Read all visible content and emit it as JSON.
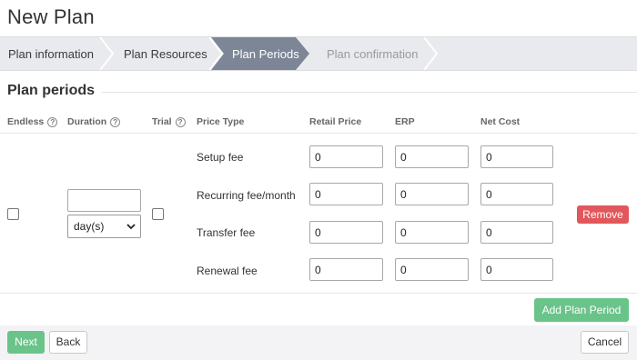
{
  "page": {
    "title": "New Plan"
  },
  "wizard": {
    "steps": [
      {
        "label": "Plan information",
        "state": "done"
      },
      {
        "label": "Plan Resources",
        "state": "done"
      },
      {
        "label": "Plan Periods",
        "state": "active"
      },
      {
        "label": "Plan confirmation",
        "state": "disabled"
      }
    ],
    "colors": {
      "bar": "#e9eaee",
      "active": "#7c8697",
      "separator": "#ffffff"
    }
  },
  "section": {
    "title": "Plan periods"
  },
  "table": {
    "headers": {
      "endless": "Endless",
      "duration": "Duration",
      "trial": "Trial",
      "price_type": "Price Type",
      "retail_price": "Retail Price",
      "erp": "ERP",
      "net_cost": "Net Cost"
    },
    "help_icon": "?",
    "row": {
      "endless_checked": false,
      "duration_value": "",
      "duration_unit": "day(s)",
      "trial_checked": false,
      "prices": [
        {
          "type": "Setup fee",
          "retail": "0",
          "erp": "0",
          "net": "0"
        },
        {
          "type": "Recurring fee/month",
          "retail": "0",
          "erp": "0",
          "net": "0"
        },
        {
          "type": "Transfer fee",
          "retail": "0",
          "erp": "0",
          "net": "0"
        },
        {
          "type": "Renewal fee",
          "retail": "0",
          "erp": "0",
          "net": "0"
        }
      ],
      "remove_label": "Remove"
    }
  },
  "actions": {
    "add_period_label": "Add Plan Period",
    "next_label": "Next",
    "back_label": "Back",
    "cancel_label": "Cancel"
  },
  "colors": {
    "primary_green": "#6ac48a",
    "danger_red": "#e2575b"
  }
}
